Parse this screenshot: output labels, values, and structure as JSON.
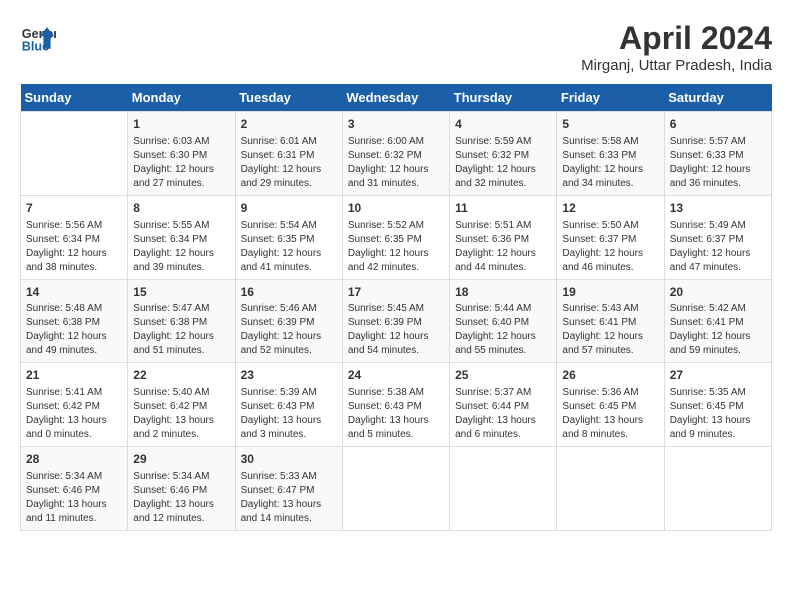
{
  "header": {
    "logo_line1": "General",
    "logo_line2": "Blue",
    "title": "April 2024",
    "subtitle": "Mirganj, Uttar Pradesh, India"
  },
  "days_of_week": [
    "Sunday",
    "Monday",
    "Tuesday",
    "Wednesday",
    "Thursday",
    "Friday",
    "Saturday"
  ],
  "weeks": [
    [
      {
        "day": "",
        "info": ""
      },
      {
        "day": "1",
        "info": "Sunrise: 6:03 AM\nSunset: 6:30 PM\nDaylight: 12 hours\nand 27 minutes."
      },
      {
        "day": "2",
        "info": "Sunrise: 6:01 AM\nSunset: 6:31 PM\nDaylight: 12 hours\nand 29 minutes."
      },
      {
        "day": "3",
        "info": "Sunrise: 6:00 AM\nSunset: 6:32 PM\nDaylight: 12 hours\nand 31 minutes."
      },
      {
        "day": "4",
        "info": "Sunrise: 5:59 AM\nSunset: 6:32 PM\nDaylight: 12 hours\nand 32 minutes."
      },
      {
        "day": "5",
        "info": "Sunrise: 5:58 AM\nSunset: 6:33 PM\nDaylight: 12 hours\nand 34 minutes."
      },
      {
        "day": "6",
        "info": "Sunrise: 5:57 AM\nSunset: 6:33 PM\nDaylight: 12 hours\nand 36 minutes."
      }
    ],
    [
      {
        "day": "7",
        "info": "Sunrise: 5:56 AM\nSunset: 6:34 PM\nDaylight: 12 hours\nand 38 minutes."
      },
      {
        "day": "8",
        "info": "Sunrise: 5:55 AM\nSunset: 6:34 PM\nDaylight: 12 hours\nand 39 minutes."
      },
      {
        "day": "9",
        "info": "Sunrise: 5:54 AM\nSunset: 6:35 PM\nDaylight: 12 hours\nand 41 minutes."
      },
      {
        "day": "10",
        "info": "Sunrise: 5:52 AM\nSunset: 6:35 PM\nDaylight: 12 hours\nand 42 minutes."
      },
      {
        "day": "11",
        "info": "Sunrise: 5:51 AM\nSunset: 6:36 PM\nDaylight: 12 hours\nand 44 minutes."
      },
      {
        "day": "12",
        "info": "Sunrise: 5:50 AM\nSunset: 6:37 PM\nDaylight: 12 hours\nand 46 minutes."
      },
      {
        "day": "13",
        "info": "Sunrise: 5:49 AM\nSunset: 6:37 PM\nDaylight: 12 hours\nand 47 minutes."
      }
    ],
    [
      {
        "day": "14",
        "info": "Sunrise: 5:48 AM\nSunset: 6:38 PM\nDaylight: 12 hours\nand 49 minutes."
      },
      {
        "day": "15",
        "info": "Sunrise: 5:47 AM\nSunset: 6:38 PM\nDaylight: 12 hours\nand 51 minutes."
      },
      {
        "day": "16",
        "info": "Sunrise: 5:46 AM\nSunset: 6:39 PM\nDaylight: 12 hours\nand 52 minutes."
      },
      {
        "day": "17",
        "info": "Sunrise: 5:45 AM\nSunset: 6:39 PM\nDaylight: 12 hours\nand 54 minutes."
      },
      {
        "day": "18",
        "info": "Sunrise: 5:44 AM\nSunset: 6:40 PM\nDaylight: 12 hours\nand 55 minutes."
      },
      {
        "day": "19",
        "info": "Sunrise: 5:43 AM\nSunset: 6:41 PM\nDaylight: 12 hours\nand 57 minutes."
      },
      {
        "day": "20",
        "info": "Sunrise: 5:42 AM\nSunset: 6:41 PM\nDaylight: 12 hours\nand 59 minutes."
      }
    ],
    [
      {
        "day": "21",
        "info": "Sunrise: 5:41 AM\nSunset: 6:42 PM\nDaylight: 13 hours\nand 0 minutes."
      },
      {
        "day": "22",
        "info": "Sunrise: 5:40 AM\nSunset: 6:42 PM\nDaylight: 13 hours\nand 2 minutes."
      },
      {
        "day": "23",
        "info": "Sunrise: 5:39 AM\nSunset: 6:43 PM\nDaylight: 13 hours\nand 3 minutes."
      },
      {
        "day": "24",
        "info": "Sunrise: 5:38 AM\nSunset: 6:43 PM\nDaylight: 13 hours\nand 5 minutes."
      },
      {
        "day": "25",
        "info": "Sunrise: 5:37 AM\nSunset: 6:44 PM\nDaylight: 13 hours\nand 6 minutes."
      },
      {
        "day": "26",
        "info": "Sunrise: 5:36 AM\nSunset: 6:45 PM\nDaylight: 13 hours\nand 8 minutes."
      },
      {
        "day": "27",
        "info": "Sunrise: 5:35 AM\nSunset: 6:45 PM\nDaylight: 13 hours\nand 9 minutes."
      }
    ],
    [
      {
        "day": "28",
        "info": "Sunrise: 5:34 AM\nSunset: 6:46 PM\nDaylight: 13 hours\nand 11 minutes."
      },
      {
        "day": "29",
        "info": "Sunrise: 5:34 AM\nSunset: 6:46 PM\nDaylight: 13 hours\nand 12 minutes."
      },
      {
        "day": "30",
        "info": "Sunrise: 5:33 AM\nSunset: 6:47 PM\nDaylight: 13 hours\nand 14 minutes."
      },
      {
        "day": "",
        "info": ""
      },
      {
        "day": "",
        "info": ""
      },
      {
        "day": "",
        "info": ""
      },
      {
        "day": "",
        "info": ""
      }
    ]
  ]
}
